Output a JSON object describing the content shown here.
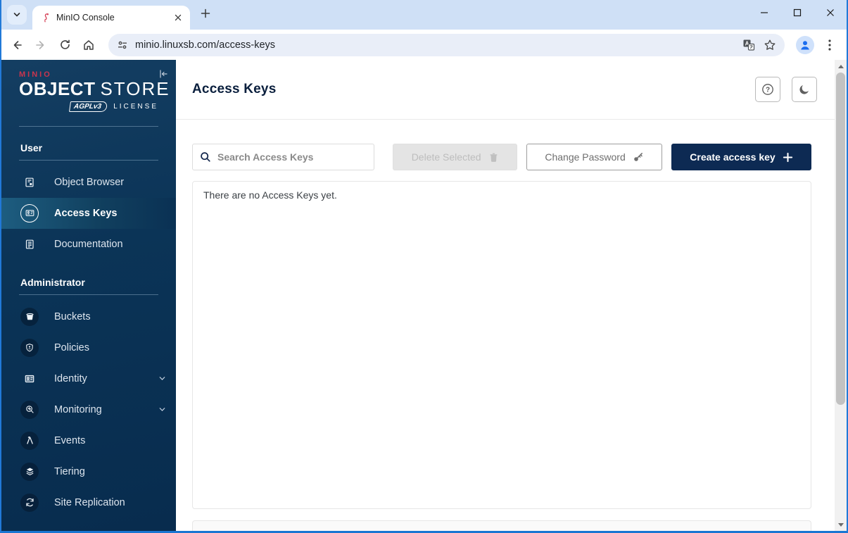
{
  "browser": {
    "tab_title": "MinIO Console",
    "url": "minio.linuxsb.com/access-keys"
  },
  "sidebar": {
    "logo": {
      "brand": "MINIO",
      "title_bold": "OBJECT",
      "title_light": "STORE",
      "badge": "AGPLv3",
      "license": "LICENSE"
    },
    "sections": [
      {
        "label": "User",
        "items": [
          {
            "label": "Object Browser",
            "icon": "object-browser-icon",
            "active": false
          },
          {
            "label": "Access Keys",
            "icon": "access-keys-icon",
            "active": true
          },
          {
            "label": "Documentation",
            "icon": "documentation-icon",
            "active": false
          }
        ]
      },
      {
        "label": "Administrator",
        "items": [
          {
            "label": "Buckets",
            "icon": "buckets-icon"
          },
          {
            "label": "Policies",
            "icon": "policies-icon"
          },
          {
            "label": "Identity",
            "icon": "identity-icon",
            "expandable": true
          },
          {
            "label": "Monitoring",
            "icon": "monitoring-icon",
            "expandable": true
          },
          {
            "label": "Events",
            "icon": "events-icon"
          },
          {
            "label": "Tiering",
            "icon": "tiering-icon"
          },
          {
            "label": "Site Replication",
            "icon": "site-replication-icon"
          }
        ]
      }
    ]
  },
  "main": {
    "title": "Access Keys",
    "toolbar": {
      "search_placeholder": "Search Access Keys",
      "delete_selected": "Delete Selected",
      "change_password": "Change Password",
      "create_access_key": "Create access key"
    },
    "empty_state": "There are no Access Keys yet."
  },
  "colors": {
    "frame_blue": "#2179d8",
    "tabstrip_blue": "#cfe0f6",
    "sidebar_navy_top": "#143e62",
    "sidebar_navy_bottom": "#082c4e",
    "brand_red": "#c9354e",
    "primary_button_navy": "#0d2a53",
    "active_item_teal": "#1d5d80"
  }
}
